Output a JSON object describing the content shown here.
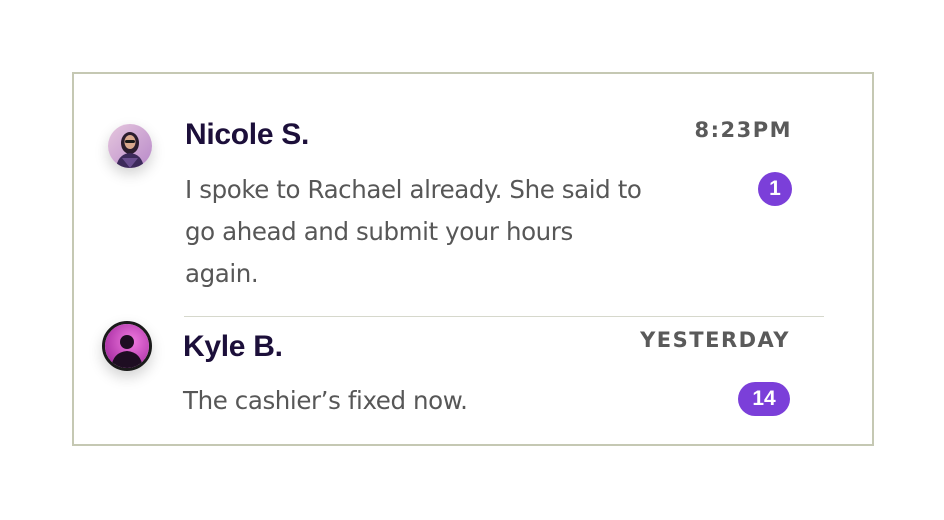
{
  "conversations": [
    {
      "name": "Nicole S.",
      "time": "8:23PM",
      "preview": "I spoke to Rachael already. She said to go ahead and submit your hours again.",
      "unread": "1",
      "avatar": "user-avatar-nicole"
    },
    {
      "name": "Kyle B.",
      "time": "YESTERDAY",
      "preview": "The cashier’s fixed now.",
      "unread": "14",
      "avatar": "user-avatar-kyle"
    }
  ],
  "colors": {
    "badge": "#7b3fd9",
    "name": "#1c0f3a",
    "border": "#c5c8b3"
  }
}
